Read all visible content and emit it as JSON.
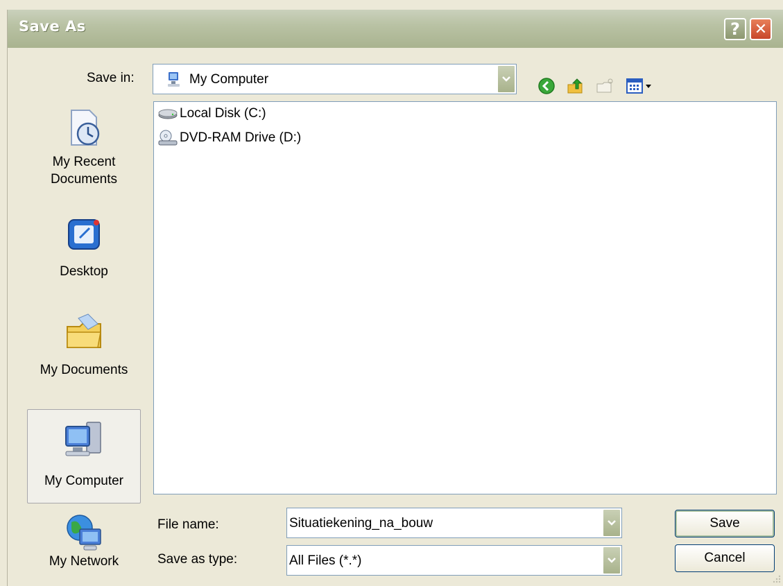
{
  "window": {
    "title": "Save As",
    "help_glyph": "?",
    "close_glyph": "✕"
  },
  "toolbar": {
    "save_in_label": "Save in:",
    "save_in_value": "My Computer",
    "icons": [
      "back-icon",
      "up-folder-icon",
      "new-folder-icon",
      "views-menu-icon"
    ]
  },
  "places": [
    {
      "label": "My Recent Documents",
      "icon": "recent-documents-icon"
    },
    {
      "label": "Desktop",
      "icon": "desktop-icon"
    },
    {
      "label": "My Documents",
      "icon": "my-documents-icon"
    },
    {
      "label": "My Computer",
      "icon": "my-computer-icon",
      "selected": true
    },
    {
      "label": "My Network",
      "icon": "network-icon"
    }
  ],
  "files": [
    {
      "name": "Local Disk (C:)",
      "icon": "hard-disk-icon"
    },
    {
      "name": "DVD-RAM Drive (D:)",
      "icon": "dvd-drive-icon"
    }
  ],
  "form": {
    "file_name_label": "File name:",
    "file_name_value": "Situatiekening_na_bouw",
    "save_type_label": "Save as type:",
    "save_type_value": "All Files (*.*)"
  },
  "buttons": {
    "save": "Save",
    "cancel": "Cancel"
  },
  "colors": {
    "title_bar": "#b9c2a4",
    "close_button": "#d0502e",
    "dialog_background": "#ece9d8",
    "field_border": "#7f9db9"
  }
}
